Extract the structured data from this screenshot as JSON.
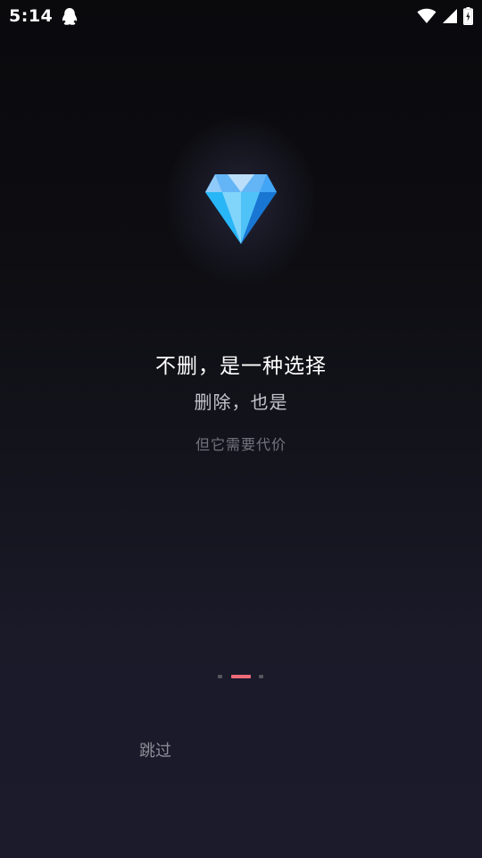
{
  "status_bar": {
    "time": "5:14",
    "notification_icon": "qq-icon",
    "wifi_icon": "wifi-icon",
    "signal_icon": "cell-signal-icon",
    "battery_icon": "battery-charging-icon"
  },
  "hero": {
    "icon": "diamond-icon",
    "headline": "不删，是一种选择",
    "subline": "删除，也是",
    "caption": "但它需要代价"
  },
  "pager": {
    "total": 3,
    "active_index": 1,
    "active_color": "#f06b78",
    "inactive_color": "#55555f"
  },
  "actions": {
    "skip_label": "跳过"
  }
}
